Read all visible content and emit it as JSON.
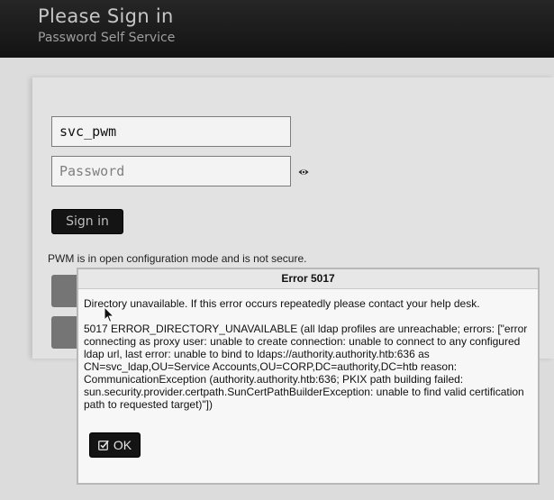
{
  "header": {
    "title": "Please Sign in",
    "subtitle": "Password Self Service"
  },
  "login": {
    "username_value": "svc_pwm",
    "password_placeholder": "Password",
    "password_toggle_icon": "eye-icon",
    "signin_label": "Sign in"
  },
  "config_note": "PWM is in open configuration mode and is not secure.",
  "dialog": {
    "title": "Error 5017",
    "message": "Directory unavailable. If this error occurs repeatedly please contact your help desk.",
    "detail": "5017 ERROR_DIRECTORY_UNAVAILABLE (all ldap profiles are unreachable; errors: [\"error connecting as proxy user: unable to create connection: unable to connect to any configured ldap url, last error: unable to bind to ldaps://authority.authority.htb:636 as CN=svc_ldap,OU=Service Accounts,OU=CORP,DC=authority,DC=htb reason: CommunicationException (authority.authority.htb:636; PKIX path building failed: sun.security.provider.certpath.SunCertPathBuilderException: unable to find valid certification path to requested target)\"])",
    "ok_label": "OK",
    "ok_icon": "check-square-icon"
  },
  "colors": {
    "header_bg": "#1a1a1a",
    "page_bg": "#dcdcdc",
    "button_bg": "#141414"
  }
}
